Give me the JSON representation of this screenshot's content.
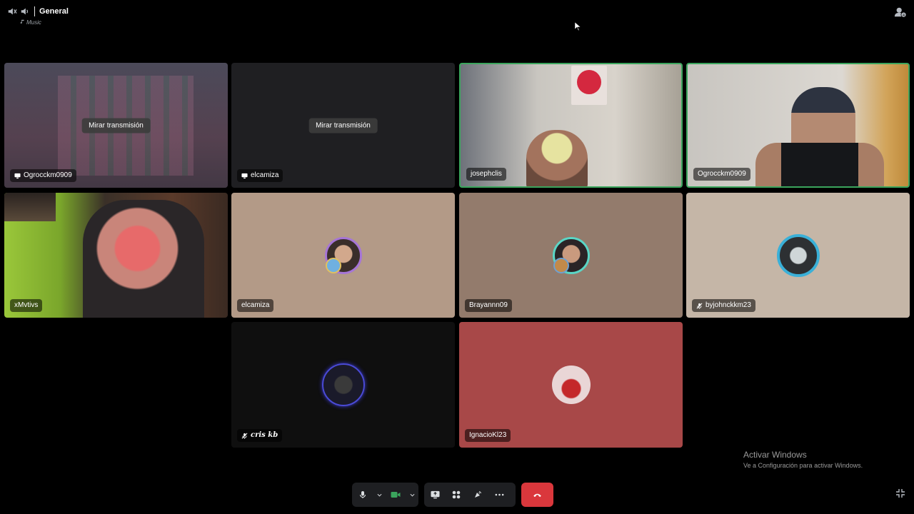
{
  "header": {
    "channel_name": "General",
    "channel_status": "Music"
  },
  "tiles": [
    {
      "id": "t1",
      "name": "Ogrocckm0909",
      "kind": "stream",
      "watch_label": "Mirar transmisión"
    },
    {
      "id": "t2",
      "name": "elcamiza",
      "kind": "stream",
      "watch_label": "Mirar transmisión"
    },
    {
      "id": "t3",
      "name": "josephclis",
      "kind": "camera"
    },
    {
      "id": "t4",
      "name": "Ogrocckm0909",
      "kind": "camera"
    },
    {
      "id": "t5",
      "name": "xMvtivs",
      "kind": "camera"
    },
    {
      "id": "t6",
      "name": "elcamiza",
      "kind": "avatar"
    },
    {
      "id": "t7",
      "name": "Brayannn09",
      "kind": "avatar"
    },
    {
      "id": "t8",
      "name": "byjohnckkm23",
      "kind": "avatar",
      "muted": true
    },
    {
      "id": "t9",
      "name": "cris kb",
      "kind": "avatar",
      "muted": true
    },
    {
      "id": "t10",
      "name": "IgnacioKl23",
      "kind": "avatar"
    }
  ],
  "watermark": {
    "title": "Activar Windows",
    "subtitle": "Ve a Configuración para activar Windows."
  },
  "icons": {
    "speaker": "speaker-icon",
    "mic": "microphone-icon",
    "camera": "camera-icon",
    "screen_share": "screen-share-icon",
    "activities": "activities-icon",
    "soundboard": "soundboard-icon",
    "more": "more-icon",
    "hangup": "hang-up-icon",
    "exit_fullscreen": "exit-fullscreen-icon",
    "invite": "invite-icon"
  },
  "colors": {
    "speaking_border": "#3ba55d",
    "hangup": "#da373c",
    "camera_on": "#3ba55d"
  }
}
